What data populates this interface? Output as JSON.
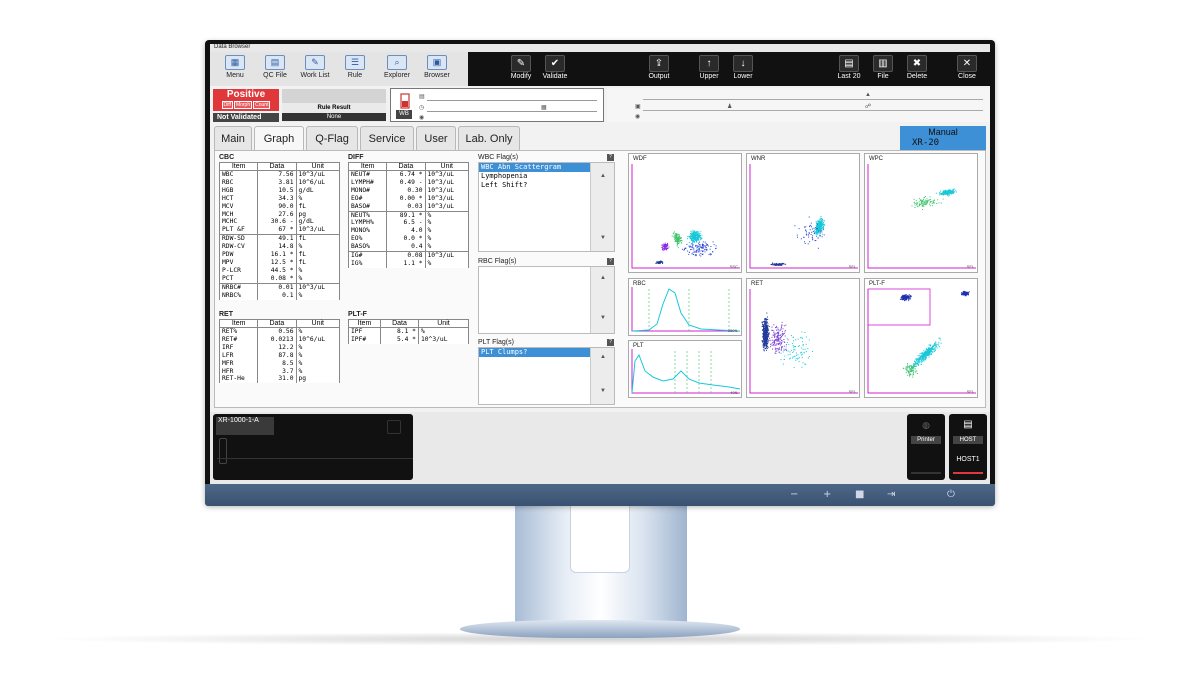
{
  "window": {
    "title": "Data Browser"
  },
  "toolbar": {
    "left": [
      {
        "label": "Menu",
        "icon": "menu-icon",
        "glyph": "▦"
      },
      {
        "label": "QC File",
        "icon": "qc-file-icon",
        "glyph": "▤"
      },
      {
        "label": "Work List",
        "icon": "work-list-icon",
        "glyph": "✎"
      },
      {
        "label": "Rule",
        "icon": "rule-icon",
        "glyph": "☰"
      },
      {
        "label": "Explorer",
        "icon": "explorer-icon",
        "glyph": "⌕"
      },
      {
        "label": "Browser",
        "icon": "browser-icon",
        "glyph": "▣"
      }
    ],
    "right": [
      {
        "label": "Modify",
        "icon": "modify-icon",
        "glyph": "✎"
      },
      {
        "label": "Validate",
        "icon": "validate-icon",
        "glyph": "✔"
      },
      {
        "label": "Output",
        "icon": "output-icon",
        "glyph": "⇪"
      },
      {
        "label": "Upper",
        "icon": "upper-icon",
        "glyph": "↑"
      },
      {
        "label": "Lower",
        "icon": "lower-icon",
        "glyph": "↓"
      },
      {
        "label": "Last 20",
        "icon": "last-20-icon",
        "glyph": "▤"
      },
      {
        "label": "File",
        "icon": "file-icon",
        "glyph": "▥"
      },
      {
        "label": "Delete",
        "icon": "delete-icon",
        "glyph": "✖"
      },
      {
        "label": "Close",
        "icon": "close-icon",
        "glyph": "✕"
      }
    ]
  },
  "status": {
    "result": "Positive",
    "mini_tags": [
      "Diff",
      "Morph",
      "Count"
    ],
    "validation": "Not Validated",
    "rule_result_label": "Rule Result",
    "rule_result_value": "None",
    "sample_badge": "WB"
  },
  "tabs": [
    "Main",
    "Graph",
    "Q-Flag",
    "Service",
    "User",
    "Lab. Only"
  ],
  "active_tab": "Graph",
  "mode": {
    "line1": "Manual",
    "line2": "XR-20"
  },
  "cbc": {
    "title": "CBC",
    "headers": [
      "Item",
      "Data",
      "Unit"
    ],
    "rows": [
      [
        "WBC",
        "7.56",
        "10^3/uL"
      ],
      [
        "RBC",
        "3.81",
        "10^6/uL"
      ],
      [
        "HGB",
        "10.5",
        "g/dL"
      ],
      [
        "HCT",
        "34.3",
        "%"
      ],
      [
        "MCV",
        "90.0",
        "fL"
      ],
      [
        "MCH",
        "27.6",
        "pg"
      ],
      [
        "MCHC",
        "30.6 -",
        "g/dL"
      ],
      [
        "PLT &F",
        "67 *",
        "10^3/uL"
      ],
      [
        "RDW-SD",
        "49.1",
        "fL"
      ],
      [
        "RDW-CV",
        "14.8",
        "%"
      ],
      [
        "PDW",
        "16.1 *",
        "fL"
      ],
      [
        "MPV",
        "12.5 *",
        "fL"
      ],
      [
        "P-LCR",
        "44.5 *",
        "%"
      ],
      [
        "PCT",
        "0.08 *",
        "%"
      ],
      [
        "NRBC#",
        "0.01",
        "10^3/uL"
      ],
      [
        "NRBC%",
        "0.1",
        "%"
      ]
    ]
  },
  "diff": {
    "title": "DIFF",
    "headers": [
      "Item",
      "Data",
      "Unit"
    ],
    "rows": [
      [
        "NEUT#",
        "6.74 *",
        "10^3/uL"
      ],
      [
        "LYMPH#",
        "0.49 -",
        "10^3/uL"
      ],
      [
        "MONO#",
        "0.30",
        "10^3/uL"
      ],
      [
        "EO#",
        "0.00 *",
        "10^3/uL"
      ],
      [
        "BASO#",
        "0.03",
        "10^3/uL"
      ],
      [
        "NEUT%",
        "89.1 *",
        "%"
      ],
      [
        "LYMPH%",
        "6.5 -",
        "%"
      ],
      [
        "MONO%",
        "4.0",
        "%"
      ],
      [
        "EO%",
        "0.0 *",
        "%"
      ],
      [
        "BASO%",
        "0.4",
        "%"
      ],
      [
        "IG#",
        "0.08",
        "10^3/uL"
      ],
      [
        "IG%",
        "1.1 *",
        "%"
      ]
    ]
  },
  "ret": {
    "title": "RET",
    "headers": [
      "Item",
      "Data",
      "Unit"
    ],
    "rows": [
      [
        "RET%",
        "0.56",
        "%"
      ],
      [
        "RET#",
        "0.0213",
        "10^6/uL"
      ],
      [
        "IRF",
        "12.2",
        "%"
      ],
      [
        "LFR",
        "87.8",
        "%"
      ],
      [
        "MFR",
        "8.5",
        "%"
      ],
      [
        "HFR",
        "3.7",
        "%"
      ],
      [
        "RET-He",
        "31.0",
        "pg"
      ]
    ]
  },
  "pltf": {
    "title": "PLT-F",
    "headers": [
      "Item",
      "Data",
      "Unit"
    ],
    "rows": [
      [
        "IPF",
        "8.1 *",
        "%"
      ],
      [
        "IPF#",
        "5.4 *",
        "10^3/uL"
      ]
    ]
  },
  "flags": {
    "wbc": {
      "title": "WBC Flag(s)",
      "items": [
        "WBC Abn Scattergram",
        "Lymphopenia",
        "Left Shift?"
      ]
    },
    "rbc": {
      "title": "RBC Flag(s)",
      "items": []
    },
    "plt": {
      "title": "PLT Flag(s)",
      "items": [
        "PLT Clumps?"
      ]
    }
  },
  "graphs": {
    "wdf": {
      "title": "WDF",
      "xlabel": "SSC"
    },
    "wnr": {
      "title": "WNR",
      "xlabel": "SFL"
    },
    "wpc": {
      "title": "WPC",
      "xlabel": "SFL"
    },
    "rbc": {
      "title": "RBC",
      "xlabel": "250fL"
    },
    "plt": {
      "title": "PLT",
      "xlabel": "40fL"
    },
    "ret": {
      "title": "RET",
      "xlabel": "SFL"
    },
    "pltf": {
      "title": "PLT-F",
      "xlabel": "SFL"
    }
  },
  "bottom": {
    "device_name": "XR-1000-1-A",
    "printer_label": "Printer",
    "host_label": "HOST",
    "host_name": "HOST1"
  },
  "colors": {
    "positive": "#e0383a",
    "selection": "#3d8fd6",
    "gate": "#d020d0",
    "cyan": "#18c8d8"
  }
}
